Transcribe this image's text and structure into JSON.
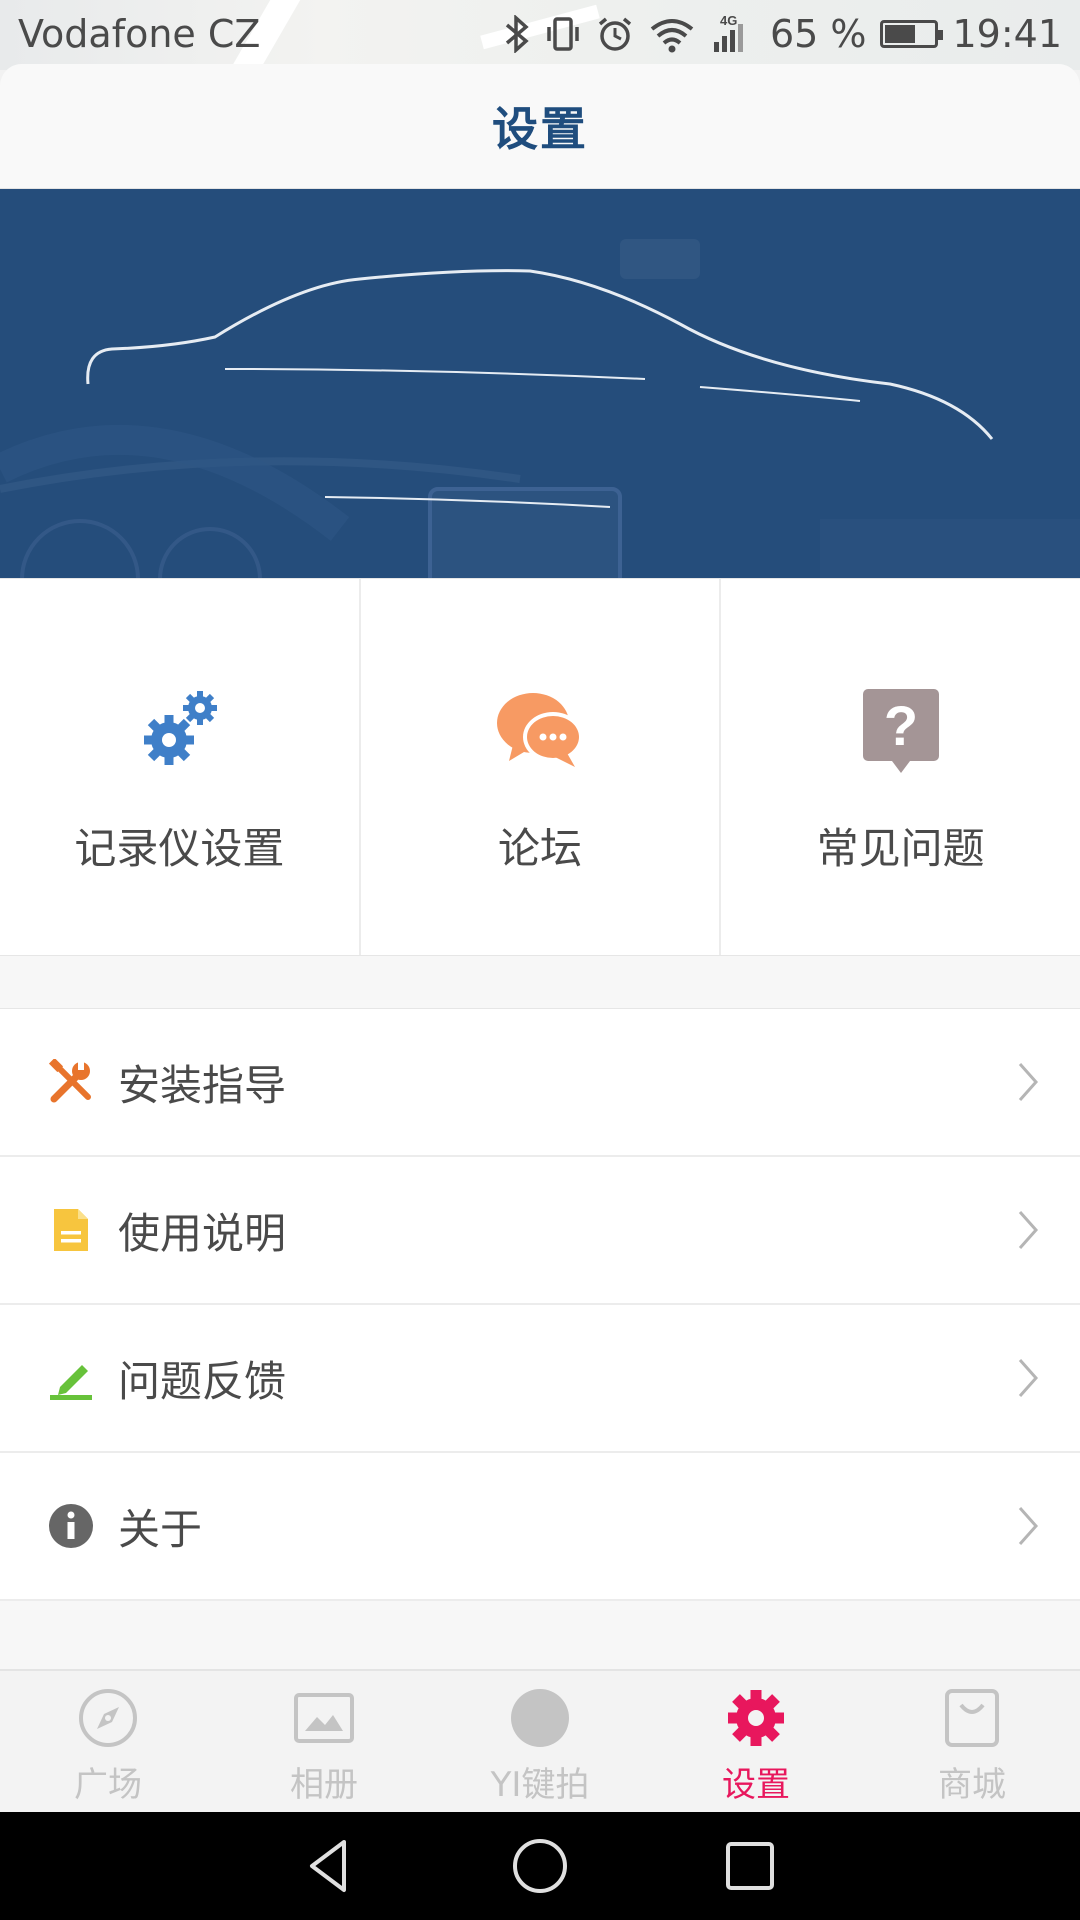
{
  "status_bar": {
    "carrier": "Vodafone CZ",
    "network": "4G",
    "battery_percent": "65 %",
    "battery_level": 0.65,
    "time": "19:41",
    "icons": [
      "bluetooth-icon",
      "vibrate-icon",
      "alarm-icon",
      "wifi-icon",
      "signal-icon",
      "battery-icon"
    ]
  },
  "header": {
    "title": "设置"
  },
  "banner": {
    "colors": {
      "background": "#254d7b",
      "outline": "#e6ecf3"
    }
  },
  "grid": [
    {
      "label": "记录仪设置",
      "icon": "gears-icon",
      "color": "#3f7fc8"
    },
    {
      "label": "论坛",
      "icon": "chat-bubbles-icon",
      "color": "#f79a63"
    },
    {
      "label": "常见问题",
      "icon": "question-icon",
      "color": "#a49596"
    }
  ],
  "list": [
    {
      "label": "安装指导",
      "icon": "tools-icon",
      "color": "#e8742c"
    },
    {
      "label": "使用说明",
      "icon": "document-icon",
      "color": "#f7c53e"
    },
    {
      "label": "问题反馈",
      "icon": "edit-icon",
      "color": "#67c23a"
    },
    {
      "label": "关于",
      "icon": "info-icon",
      "color": "#666666"
    }
  ],
  "bottom_nav": [
    {
      "label": "广场",
      "icon": "compass-icon",
      "active": false
    },
    {
      "label": "相册",
      "icon": "album-icon",
      "active": false
    },
    {
      "label": "YI键拍",
      "icon": "capture-icon",
      "active": false
    },
    {
      "label": "设置",
      "icon": "gear-icon",
      "active": true
    },
    {
      "label": "商城",
      "icon": "shopping-bag-icon",
      "active": false
    }
  ],
  "colors": {
    "accent": "#e8175d",
    "title": "#1f4d7e",
    "inactive": "#c4c4c4"
  }
}
